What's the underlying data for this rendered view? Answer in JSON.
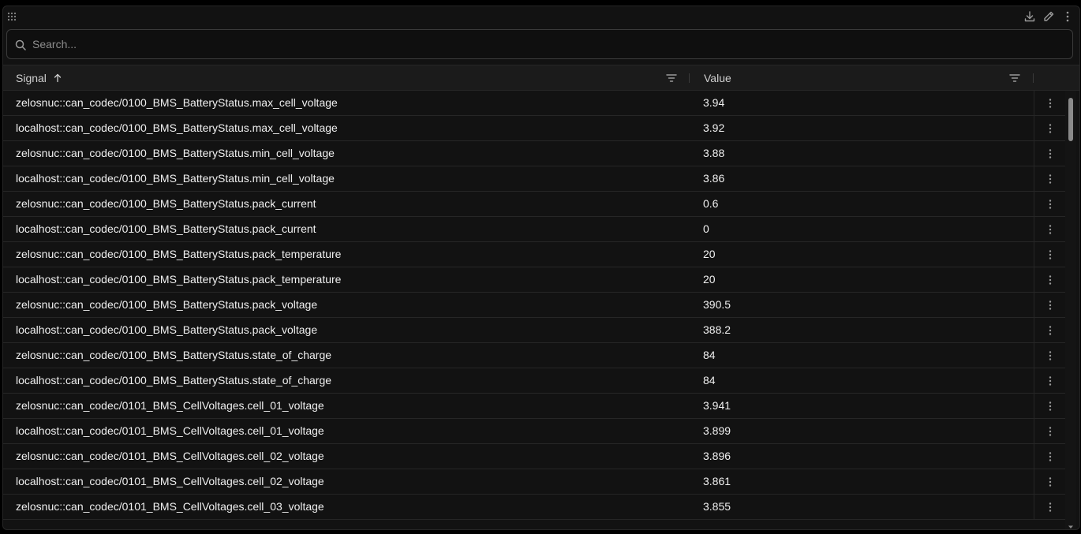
{
  "search": {
    "placeholder": "Search..."
  },
  "table": {
    "columns": [
      {
        "label": "Signal",
        "sort": "ascending"
      },
      {
        "label": "Value"
      }
    ],
    "rows": [
      {
        "signal": "zelosnuc::can_codec/0100_BMS_BatteryStatus.max_cell_voltage",
        "value": "3.94"
      },
      {
        "signal": "localhost::can_codec/0100_BMS_BatteryStatus.max_cell_voltage",
        "value": "3.92"
      },
      {
        "signal": "zelosnuc::can_codec/0100_BMS_BatteryStatus.min_cell_voltage",
        "value": "3.88"
      },
      {
        "signal": "localhost::can_codec/0100_BMS_BatteryStatus.min_cell_voltage",
        "value": "3.86"
      },
      {
        "signal": "zelosnuc::can_codec/0100_BMS_BatteryStatus.pack_current",
        "value": "0.6"
      },
      {
        "signal": "localhost::can_codec/0100_BMS_BatteryStatus.pack_current",
        "value": "0"
      },
      {
        "signal": "zelosnuc::can_codec/0100_BMS_BatteryStatus.pack_temperature",
        "value": "20"
      },
      {
        "signal": "localhost::can_codec/0100_BMS_BatteryStatus.pack_temperature",
        "value": "20"
      },
      {
        "signal": "zelosnuc::can_codec/0100_BMS_BatteryStatus.pack_voltage",
        "value": "390.5"
      },
      {
        "signal": "localhost::can_codec/0100_BMS_BatteryStatus.pack_voltage",
        "value": "388.2"
      },
      {
        "signal": "zelosnuc::can_codec/0100_BMS_BatteryStatus.state_of_charge",
        "value": "84"
      },
      {
        "signal": "localhost::can_codec/0100_BMS_BatteryStatus.state_of_charge",
        "value": "84"
      },
      {
        "signal": "zelosnuc::can_codec/0101_BMS_CellVoltages.cell_01_voltage",
        "value": "3.941"
      },
      {
        "signal": "localhost::can_codec/0101_BMS_CellVoltages.cell_01_voltage",
        "value": "3.899"
      },
      {
        "signal": "zelosnuc::can_codec/0101_BMS_CellVoltages.cell_02_voltage",
        "value": "3.896"
      },
      {
        "signal": "localhost::can_codec/0101_BMS_CellVoltages.cell_02_voltage",
        "value": "3.861"
      },
      {
        "signal": "zelosnuc::can_codec/0101_BMS_CellVoltages.cell_03_voltage",
        "value": "3.855"
      }
    ]
  },
  "icons": {
    "toolbar": [
      "download-icon",
      "pencil-icon",
      "more-vertical-icon"
    ],
    "drag": "grid-dots-icon",
    "search": "search-icon",
    "sort": "arrow-up-icon",
    "filter": "filter-icon",
    "row_menu": "more-vertical-icon"
  }
}
